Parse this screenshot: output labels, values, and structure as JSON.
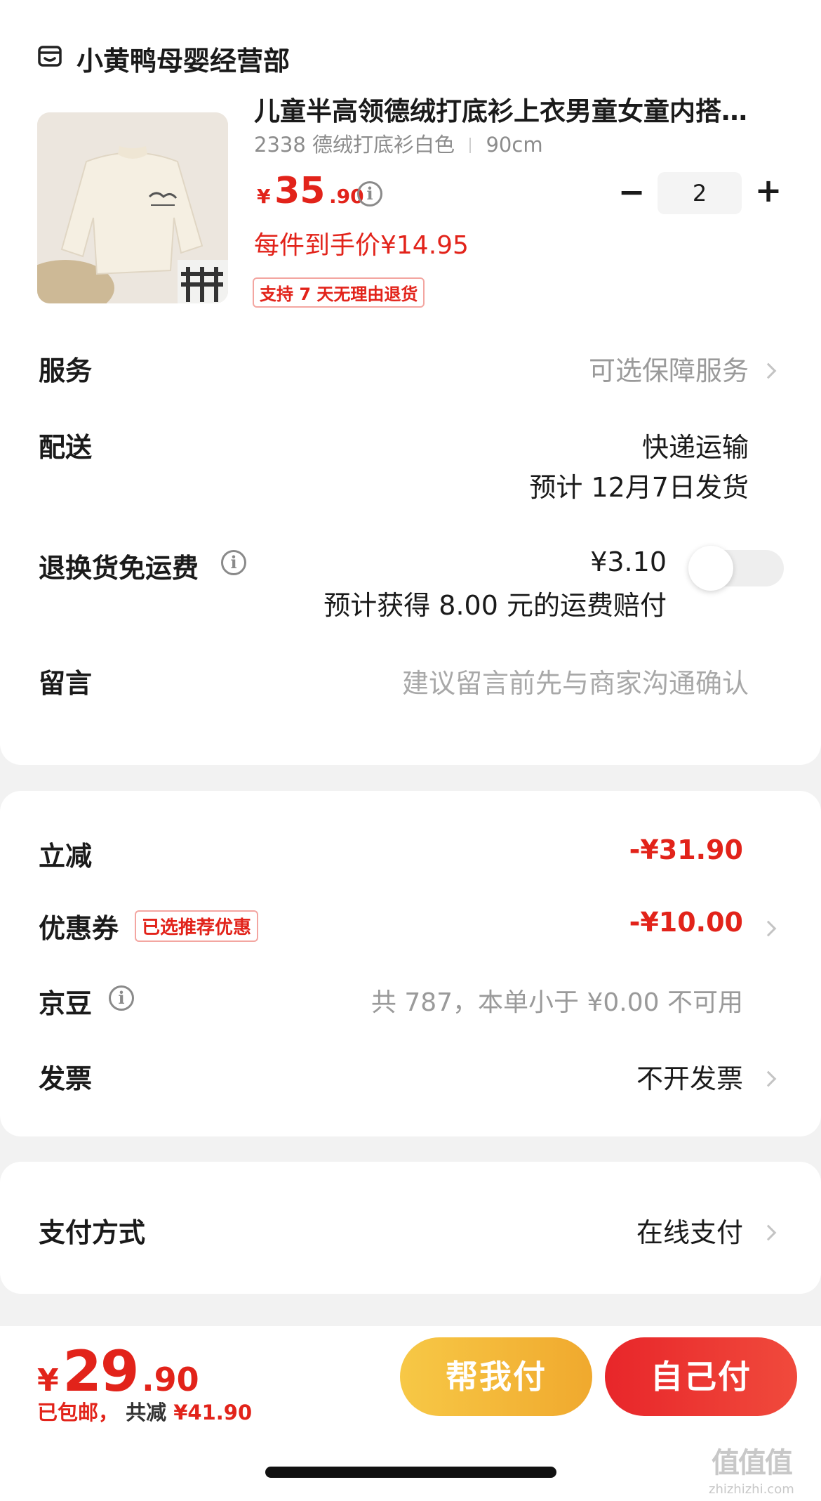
{
  "store": {
    "name": "小黄鸭母婴经营部",
    "icon": "store-icon"
  },
  "product": {
    "title": "儿童半高领德绒打底衫上衣男童女童内搭…",
    "spec_style": "2338 德绒打底衫白色",
    "spec_size": "90cm",
    "price_symbol": "¥",
    "price_int": "35",
    "price_dec": ".90",
    "unit_price": "每件到手价¥14.95",
    "return_badge": "支持 7 天无理由退货",
    "quantity": "2",
    "minus": "−",
    "plus": "+"
  },
  "rows": {
    "service": {
      "label": "服务",
      "value": "可选保障服务"
    },
    "delivery": {
      "label": "配送",
      "value": "快递运输",
      "sub": "预计 12月7日发货"
    },
    "return_free": {
      "label": "退换货免运费",
      "price": "¥3.10",
      "sub": "预计获得 8.00 元的运费赔付",
      "toggle_on": false
    },
    "message": {
      "label": "留言",
      "placeholder": "建议留言前先与商家沟通确认"
    }
  },
  "discounts": {
    "instant": {
      "label": "立减",
      "value": "-¥31.90"
    },
    "coupon": {
      "label": "优惠券",
      "badge": "已选推荐优惠",
      "value": "-¥10.00"
    },
    "jingdou": {
      "label": "京豆",
      "value": "共 787，本单小于 ¥0.00 不可用"
    },
    "invoice": {
      "label": "发票",
      "value": "不开发票"
    }
  },
  "payment": {
    "label": "支付方式",
    "value": "在线支付"
  },
  "footer": {
    "symbol": "¥",
    "total_int": "29",
    "total_dec": ".90",
    "shipping_note": "已包邮，",
    "saved_label": "共减 ",
    "saved_value": "¥41.90",
    "help_pay": "帮我付",
    "self_pay": "自己付"
  },
  "watermark": {
    "logo": "值值值",
    "url": "zhizhizhi.com"
  },
  "colors": {
    "accent": "#e2231a",
    "help_pay_start": "#f7c846",
    "help_pay_end": "#f0a92e",
    "self_pay_start": "#e8262a",
    "self_pay_end": "#f04a3c"
  }
}
